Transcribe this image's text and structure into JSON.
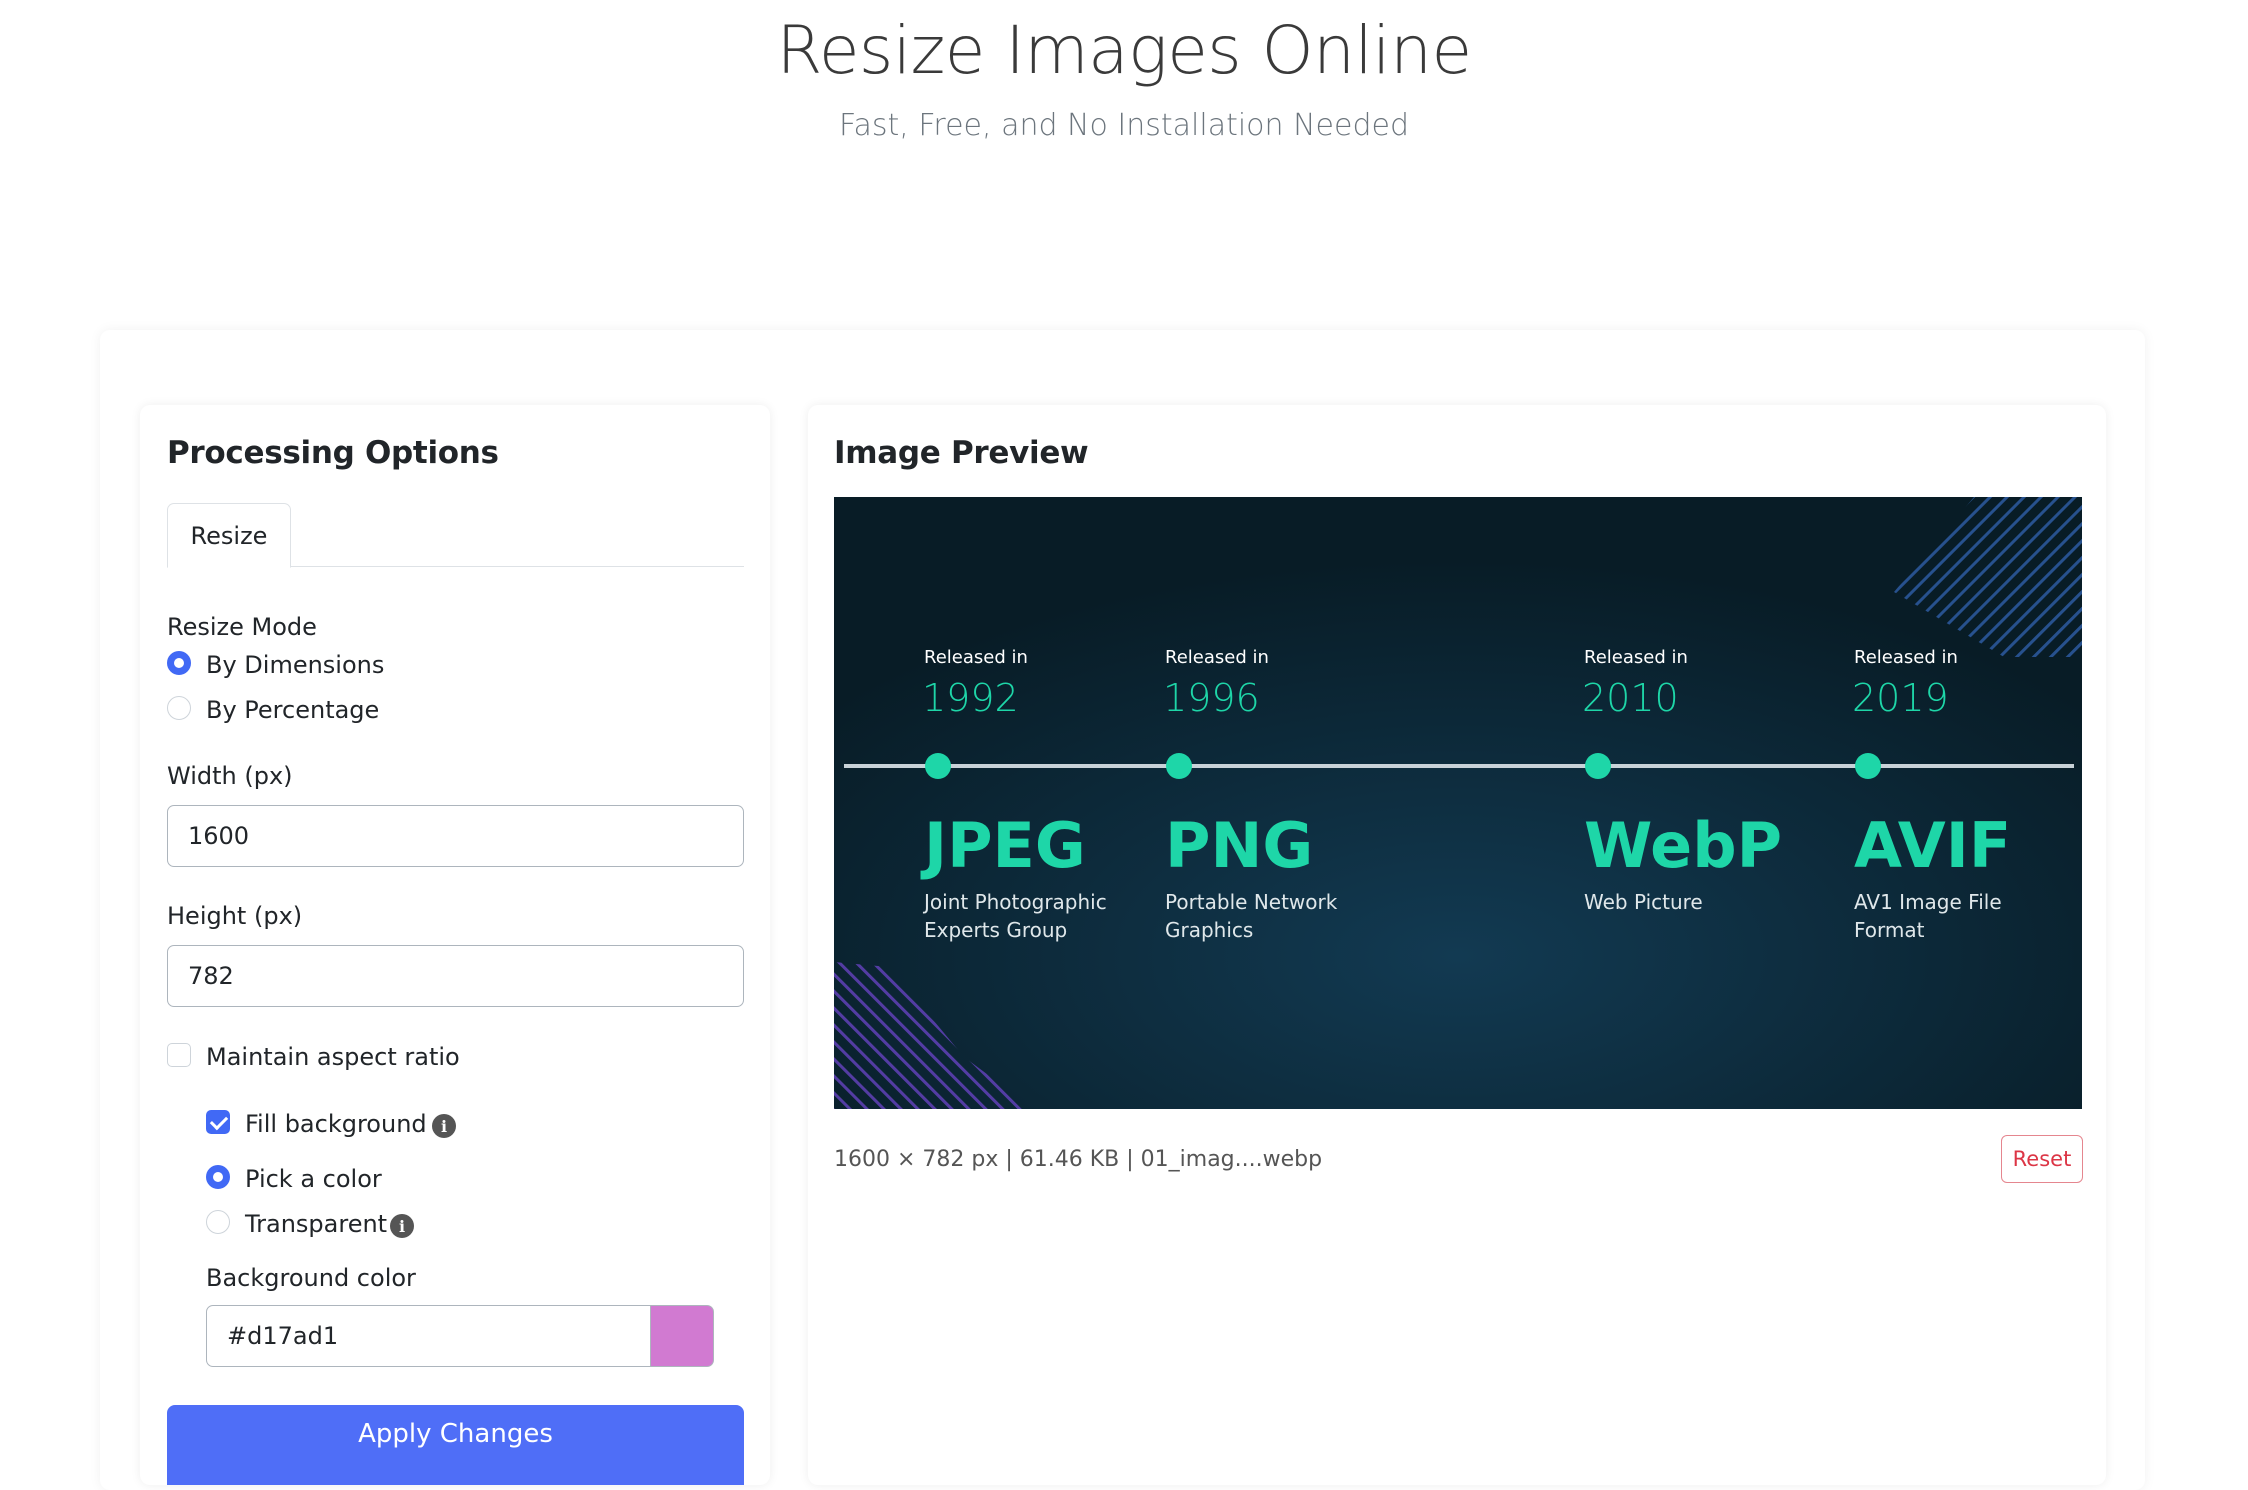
{
  "hero": {
    "title": "Resize Images Online",
    "subtitle": "Fast, Free, and No Installation Needed"
  },
  "options": {
    "heading": "Processing Options",
    "tab_resize": "Resize",
    "resize_mode_label": "Resize Mode",
    "mode_dimensions": "By Dimensions",
    "mode_percentage": "By Percentage",
    "width_label": "Width (px)",
    "width_value": "1600",
    "height_label": "Height (px)",
    "height_value": "782",
    "maintain_aspect": "Maintain aspect ratio",
    "fill_background": "Fill background",
    "pick_color": "Pick a color",
    "transparent": "Transparent",
    "bg_color_label": "Background color",
    "bg_color_value": "#d17ad1",
    "apply": "Apply Changes"
  },
  "preview": {
    "heading": "Image Preview",
    "meta": "1600 × 782 px | 61.46 KB | 01_imag....webp",
    "reset": "Reset",
    "image": {
      "released": "Released in",
      "items": [
        {
          "year": "1992",
          "name": "JPEG",
          "desc1": "Joint Photographic",
          "desc2": "Experts Group"
        },
        {
          "year": "1996",
          "name": "PNG",
          "desc1": "Portable Network",
          "desc2": "Graphics"
        },
        {
          "year": "2010",
          "name": "WebP",
          "desc1": "Web Picture",
          "desc2": ""
        },
        {
          "year": "2019",
          "name": "AVIF",
          "desc1": "AV1 Image File",
          "desc2": "Format"
        }
      ]
    }
  },
  "colors": {
    "accent": "#4169f5",
    "button": "#4f6ef7",
    "swatch": "#d17ad1",
    "teal": "#1ed6a8"
  }
}
